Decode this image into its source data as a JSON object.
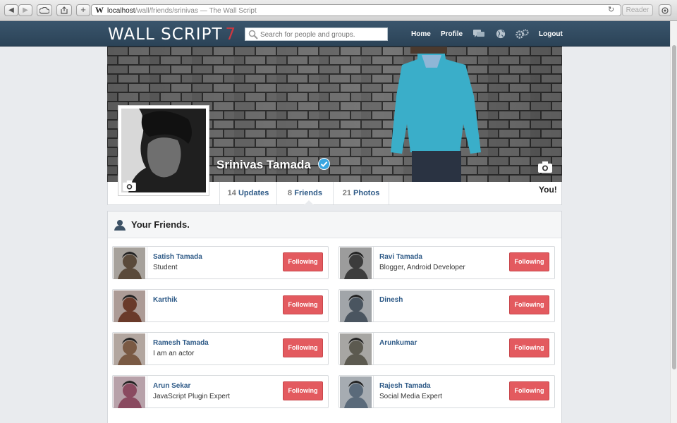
{
  "browser": {
    "address_host": "localhost",
    "address_path": "/wall/friends/srinivas",
    "page_title": " — The Wall Script",
    "site_letter": "W",
    "reader_label": "Reader"
  },
  "header": {
    "logo_text": "WALL SCRIPT",
    "logo_version": "7",
    "search_placeholder": "Search for people and groups.",
    "nav": {
      "home": "Home",
      "profile": "Profile",
      "logout": "Logout"
    }
  },
  "profile": {
    "name": "Srinivas Tamada",
    "verified": true,
    "tabs": [
      {
        "count": "14",
        "label": "Updates"
      },
      {
        "count": "8",
        "label": "Friends"
      },
      {
        "count": "21",
        "label": "Photos"
      }
    ],
    "you_label": "You!"
  },
  "friends": {
    "title": "Your Friends.",
    "button_label": "Following",
    "items": [
      {
        "name": "Satish Tamada",
        "desc": "Student",
        "color": "#5a4a3a"
      },
      {
        "name": "Ravi Tamada",
        "desc": "Blogger, Android Developer",
        "color": "#3c3c3c"
      },
      {
        "name": "Karthik",
        "desc": "",
        "color": "#6a3a2a"
      },
      {
        "name": "Dinesh",
        "desc": "",
        "color": "#4a5560"
      },
      {
        "name": "Ramesh Tamada",
        "desc": "I am an actor",
        "color": "#7a5a44"
      },
      {
        "name": "Arunkumar",
        "desc": "",
        "color": "#5c5a50"
      },
      {
        "name": "Arun Sekar",
        "desc": "JavaScript Plugin Expert",
        "color": "#8a4a60"
      },
      {
        "name": "Rajesh Tamada",
        "desc": "Social Media Expert",
        "color": "#5a6a7a"
      }
    ]
  },
  "colors": {
    "header": "#2e475b",
    "accent": "#e35a5f",
    "link": "#2e5a87"
  }
}
